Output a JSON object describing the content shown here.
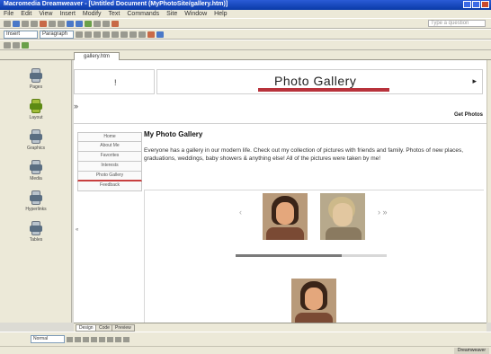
{
  "window": {
    "title": "Macromedia Dreamweaver - [Untitled Document (MyPhotoSite/gallery.htm)]"
  },
  "menu": {
    "items": [
      "File",
      "Edit",
      "View",
      "Insert",
      "Modify",
      "Text",
      "Commands",
      "Site",
      "Window",
      "Help"
    ]
  },
  "toolbar": {
    "view_combo": "Insert",
    "format_combo": "Paragraph"
  },
  "search": {
    "placeholder": "Type a question"
  },
  "document_tab": {
    "label": "gallery.htm"
  },
  "sidebar": {
    "items": [
      {
        "label": "Pages",
        "icon": "pages-icon"
      },
      {
        "label": "Layout",
        "icon": "layout-icon"
      },
      {
        "label": "Graphics",
        "icon": "graphics-icon"
      },
      {
        "label": "Media",
        "icon": "media-icon"
      },
      {
        "label": "Hyperlinks",
        "icon": "hyperlink-icon"
      },
      {
        "label": "Tables",
        "icon": "tables-icon"
      }
    ]
  },
  "page": {
    "left_marker": "!",
    "title": "Photo Gallery",
    "nav_arrow": "▸",
    "section_marker": "»",
    "right_link": "Get Photos",
    "nav_items": [
      "Home",
      "About Me",
      "Favorites",
      "Interests",
      "Photo Gallery",
      "Feedback"
    ],
    "selected_nav": 4,
    "nav_arrow_left": "«",
    "heading": "My Photo Gallery",
    "body": "Everyone has a gallery in our modern life. Check out my collection of pictures with friends and family. Photos of new places, graduations, weddings, baby showers & anything else! All of the pictures were taken by me!",
    "gallery_prev": "‹",
    "gallery_next": "› »",
    "scroll_fraction": 0.7
  },
  "bottom_tabs": {
    "items": [
      "Design",
      "Code",
      "Preview"
    ],
    "active": 0
  },
  "status": {
    "combo": "Normal"
  },
  "taskbar": {
    "tray_label": "Dreamweaver"
  }
}
